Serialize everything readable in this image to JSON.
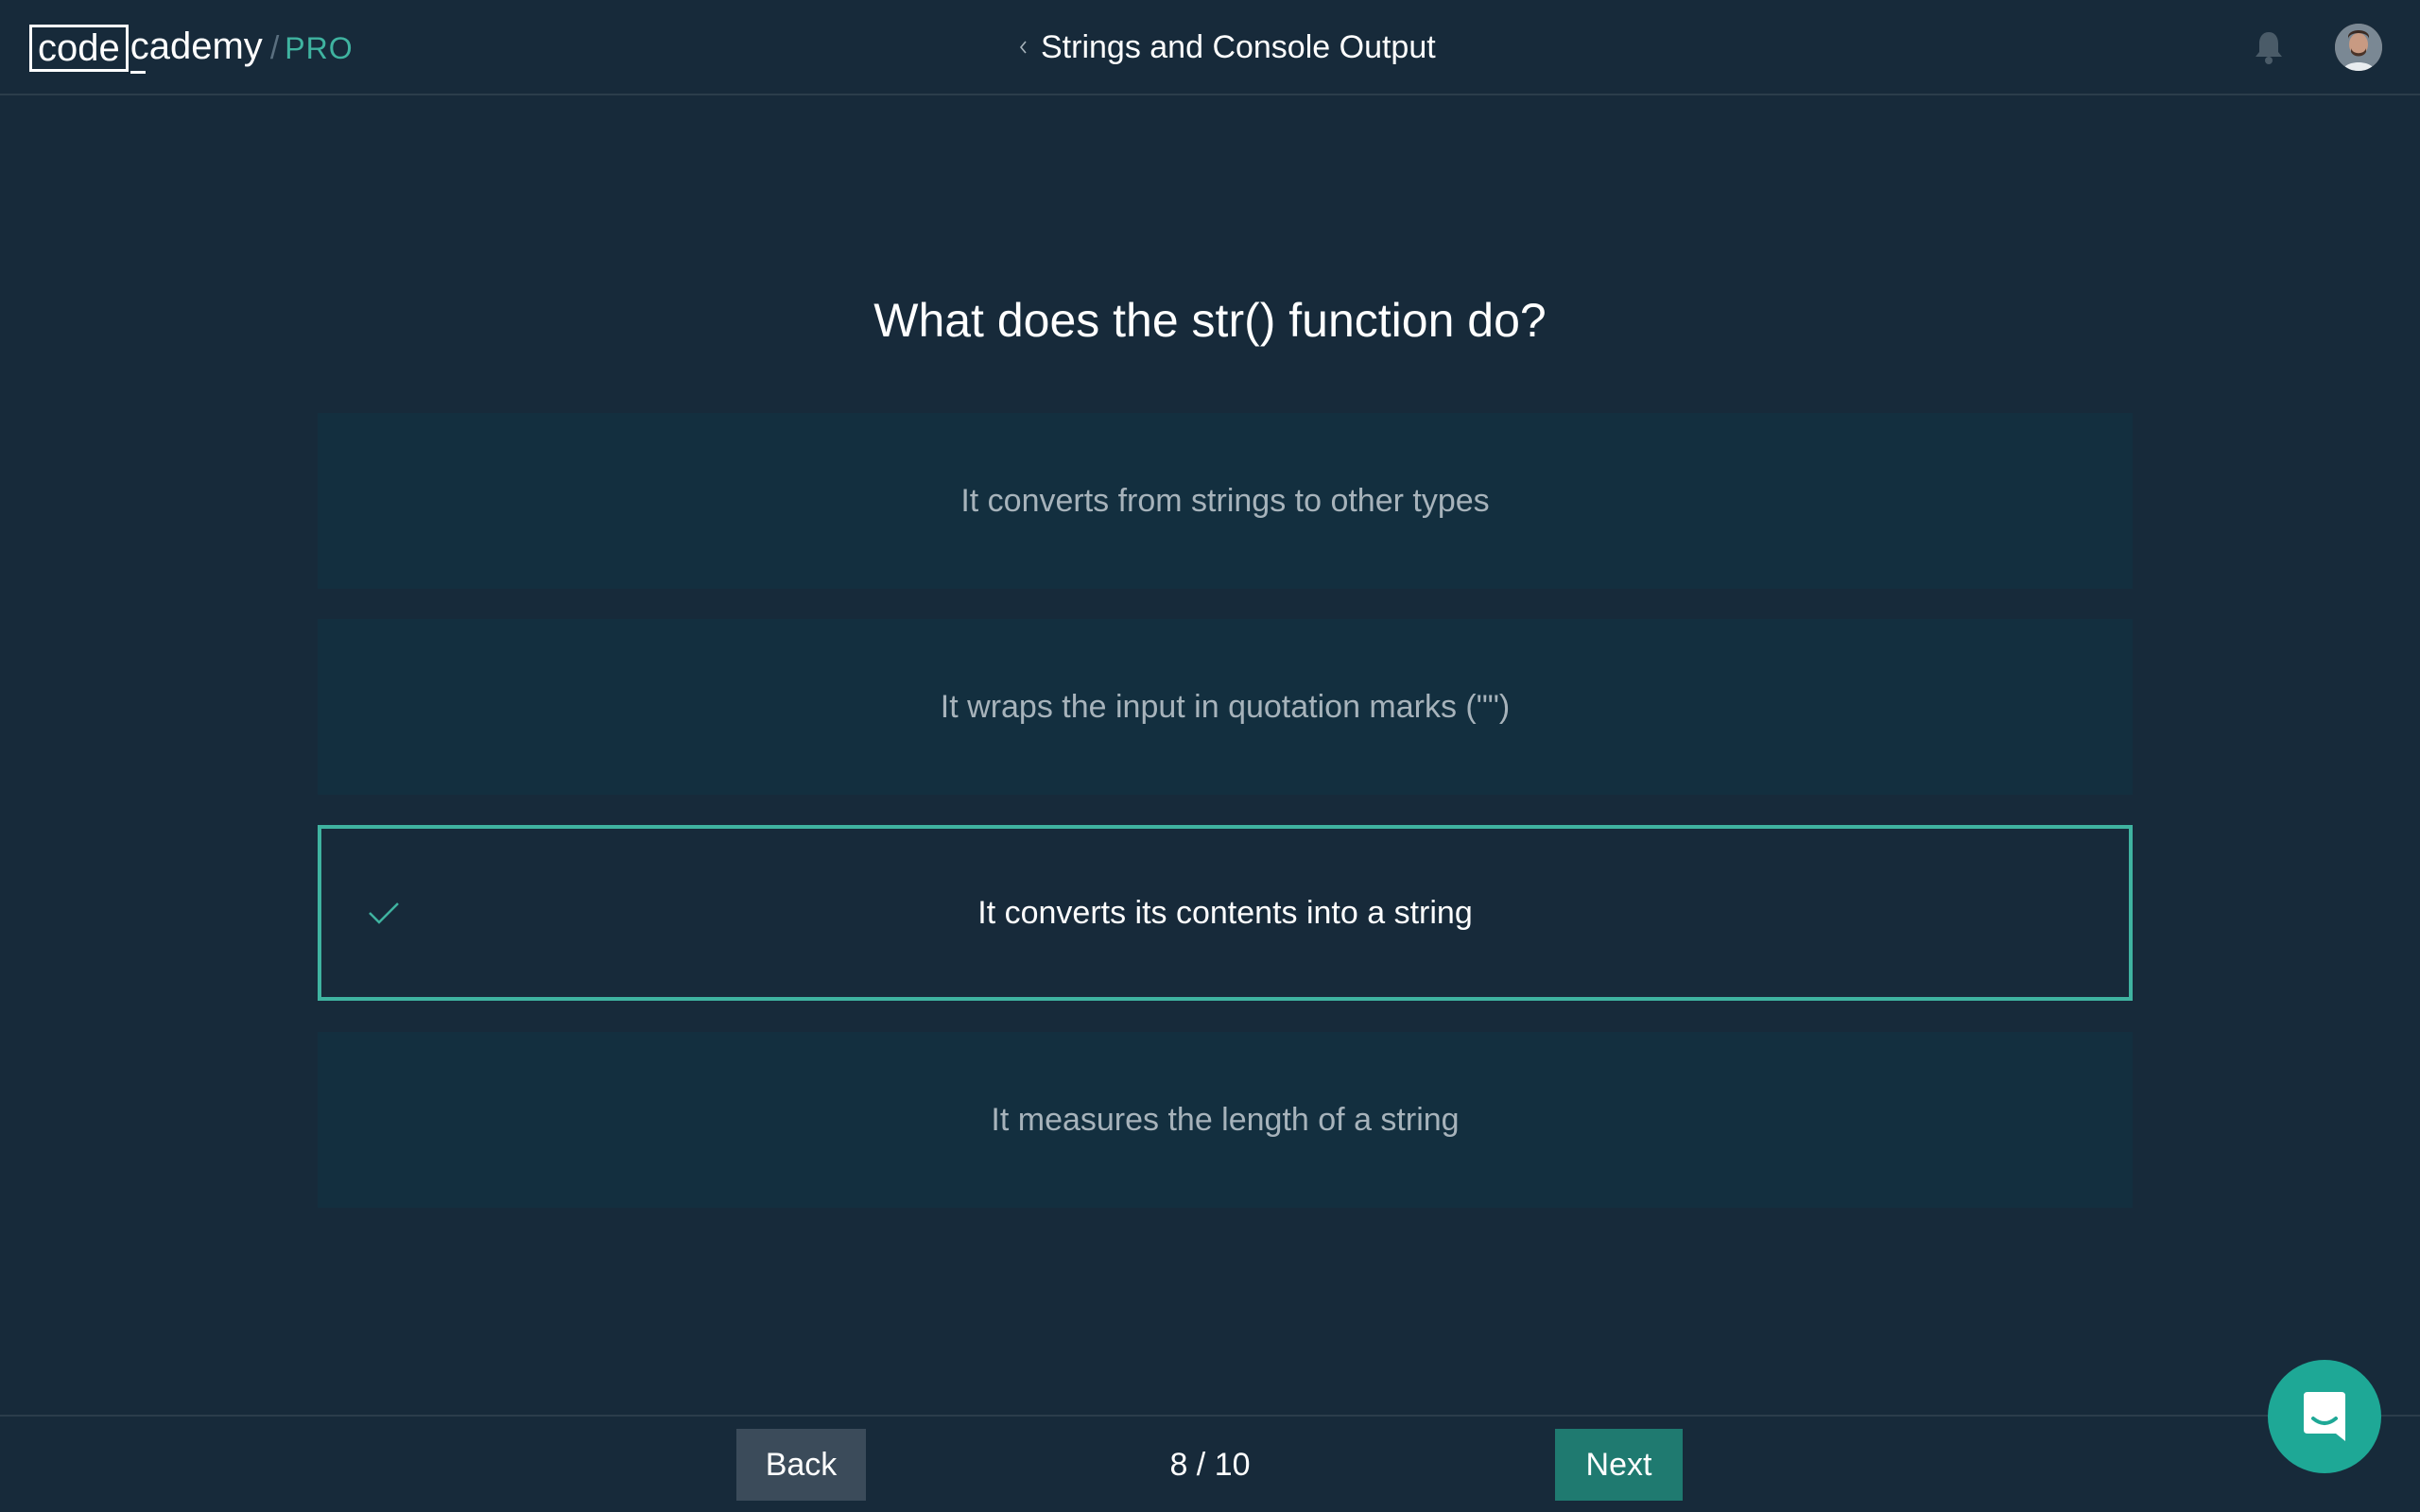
{
  "header": {
    "logo_code": "code",
    "logo_rest": "cademy",
    "logo_slash": "/",
    "logo_pro": "PRO",
    "lesson_title": "Strings and Console Output",
    "icons": [
      "chevron-left-icon",
      "bell-icon",
      "avatar"
    ]
  },
  "quiz": {
    "question": "What does the str() function do?",
    "answers": [
      {
        "label": "It converts from strings to other types",
        "selected": false
      },
      {
        "label": "It wraps the input in quotation marks (\"\")",
        "selected": false
      },
      {
        "label": "It converts its contents into a string",
        "selected": true
      },
      {
        "label": "It measures the length of a string",
        "selected": false
      }
    ]
  },
  "footer": {
    "back_label": "Back",
    "progress": "8 / 10",
    "next_label": "Next"
  },
  "colors": {
    "background": "#172a3a",
    "answer_bg": "#132f3f",
    "accent": "#3fb3a0",
    "next_button": "#1f7a70",
    "back_button": "#3b4b5a",
    "chat_button": "#1ea896"
  }
}
